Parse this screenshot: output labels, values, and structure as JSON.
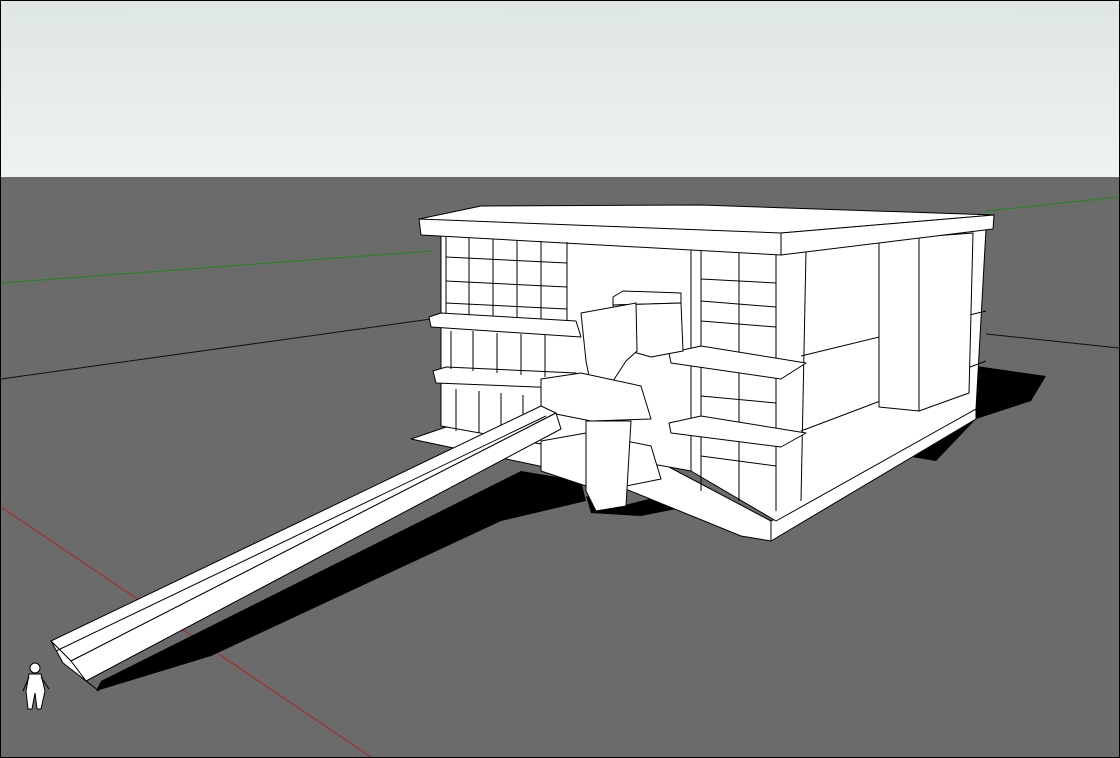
{
  "viewport": {
    "kind": "3d-modeling-viewport",
    "sky_top_color": "#dfe6e6",
    "sky_bottom_color": "#eef2f2",
    "ground_color": "#6b6b6b",
    "model_face_color": "#ffffff",
    "model_edge_color": "#000000",
    "shadow_color": "#000000",
    "axis_colors": {
      "green_axis": "#1a8a1a",
      "red_axis": "#b22222",
      "blue_axis": "#1a1a8a",
      "black_axis": "#111111"
    },
    "scene_objects": [
      "building-model",
      "ramp",
      "stair-tower",
      "person-scale-figure",
      "axis-lines",
      "shadows"
    ]
  }
}
